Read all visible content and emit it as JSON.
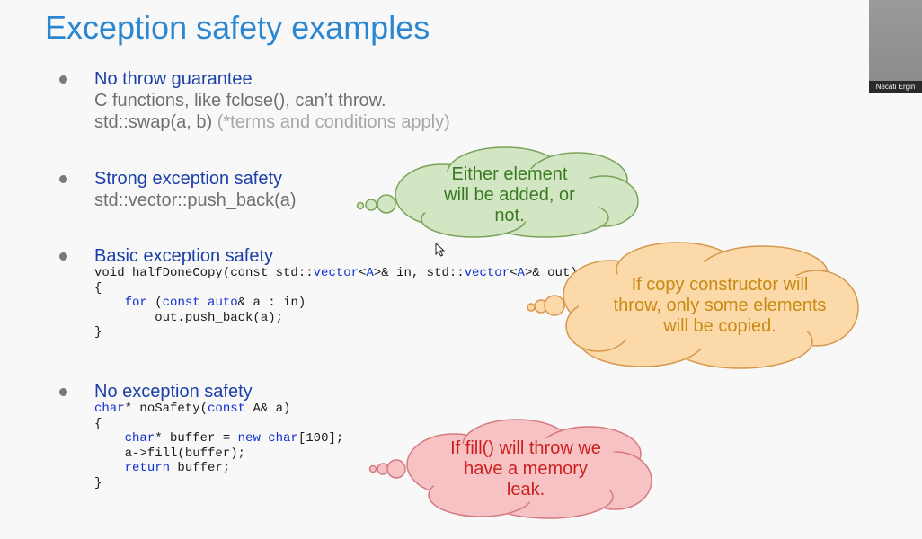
{
  "slide": {
    "title": "Exception safety examples",
    "sections": [
      {
        "heading": "No throw guarantee",
        "line1": "C functions, like fclose(), can’t throw.",
        "line2_main": "std::swap(a, b)",
        "line2_note": "(*terms and conditions apply)"
      },
      {
        "heading": "Strong exception safety",
        "line1": "std::vector::push_back(a)"
      },
      {
        "heading": "Basic exception safety"
      },
      {
        "heading": "No exception safety"
      }
    ]
  },
  "code_basic": {
    "l1_a": "void halfDoneCopy(const std::",
    "l1_b": "vector",
    "l1_c": "<",
    "l1_d": "A",
    "l1_e": ">& in, std::",
    "l1_f": "vector",
    "l1_g": "<",
    "l1_h": "A",
    "l1_i": ">& out)",
    "l2": "{",
    "l3_a": "    ",
    "l3_b": "for",
    "l3_c": " (",
    "l3_d": "const auto",
    "l3_e": "& a : in)",
    "l4": "        out.push_back(a);",
    "l5": "}"
  },
  "code_none": {
    "l1_a": "char",
    "l1_b": "* noSafety(",
    "l1_c": "const",
    "l1_d": " A& a)",
    "l2": "{",
    "l3_a": "    ",
    "l3_b": "char",
    "l3_c": "* buffer = ",
    "l3_d": "new char",
    "l3_e": "[100];",
    "l4": "    a->fill(buffer);",
    "l5_a": "    ",
    "l5_b": "return",
    "l5_c": " buffer;",
    "l6": "}"
  },
  "clouds": [
    {
      "text": "Either element will be added, or not.",
      "fill": "#d3e6c4",
      "stroke": "#7aa35a",
      "text_color": "#3a7a22"
    },
    {
      "text": "If copy constructor will throw, only some elements will be copied.",
      "fill": "#fbd9a8",
      "stroke": "#d6974a",
      "text_color": "#c98a12"
    },
    {
      "text": "If fill() will throw we have a memory leak.",
      "fill": "#f7c2c4",
      "stroke": "#d47a80",
      "text_color": "#cc2020"
    }
  ],
  "webcam": {
    "name": "Necati Ergin"
  }
}
